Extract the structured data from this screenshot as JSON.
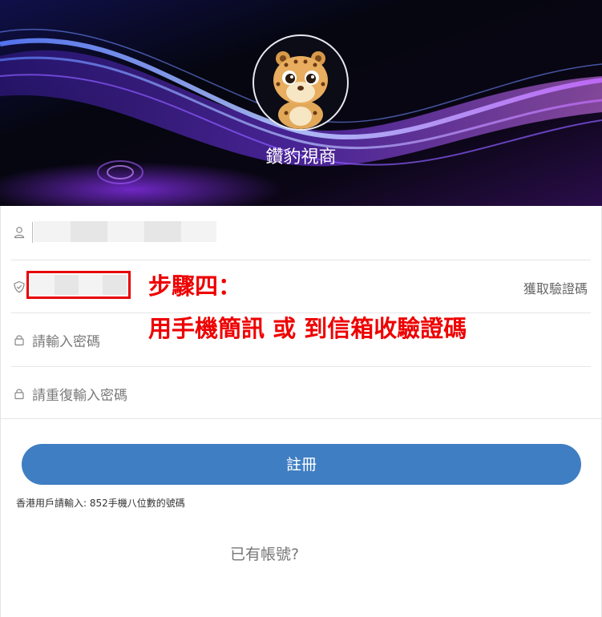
{
  "header": {
    "brand_name": "鑽豹視商",
    "logo_icon": "leopard-cub-mascot"
  },
  "form": {
    "username_icon": "user-icon",
    "code_icon": "shield-icon",
    "get_code_label": "獲取驗證碼",
    "password_icon": "lock-icon",
    "password_placeholder": "請輸入密碼",
    "confirm_icon": "lock-icon",
    "confirm_placeholder": "請重復輸入密碼"
  },
  "annotation": {
    "line1": "步驟四：",
    "line2": "用手機簡訊 或 到信箱收驗證碼",
    "color": "#ee0000"
  },
  "register": {
    "button_label": "註冊",
    "color": "#3f7ec3"
  },
  "hint_text": "香港用戶請輸入: 852手機八位數的號碼",
  "login_link": "已有帳號?"
}
